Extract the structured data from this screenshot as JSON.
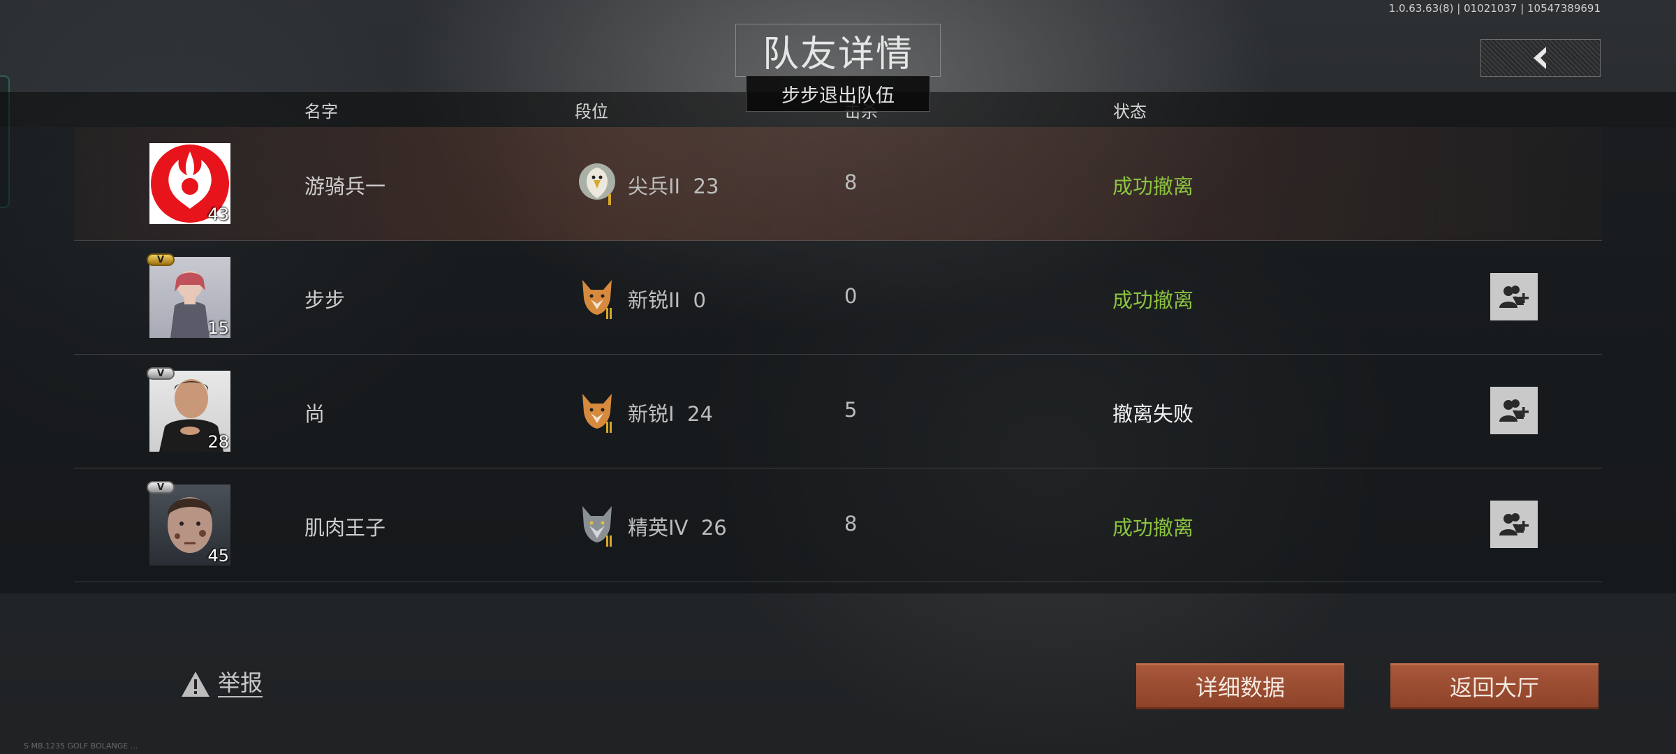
{
  "version_info": "1.0.63.63(8) | 01021037 | 10547389691",
  "title": "队友详情",
  "toast": "步步退出队伍",
  "columns": {
    "name": "名字",
    "rank": "段位",
    "kills": "击杀",
    "status": "状态"
  },
  "rows": [
    {
      "name": "游骑兵一",
      "level": "43",
      "rank": "尖兵II",
      "rank_points": "23",
      "kills": "8",
      "status": "成功撤离",
      "status_type": "success",
      "vip": "",
      "is_self": true,
      "avatar": "rebel-emblem",
      "rank_icon": "eagle-rank-icon"
    },
    {
      "name": "步步",
      "level": "15",
      "rank": "新锐II",
      "rank_points": "0",
      "kills": "0",
      "status": "成功撤离",
      "status_type": "success",
      "vip": "V",
      "vip_style": "gold",
      "is_self": false,
      "avatar": "anime-character-photo",
      "rank_icon": "fox-rank-icon"
    },
    {
      "name": "尚",
      "level": "28",
      "rank": "新锐I",
      "rank_points": "24",
      "kills": "5",
      "status": "撤离失败",
      "status_type": "fail",
      "vip": "V",
      "vip_style": "silver",
      "is_self": false,
      "avatar": "man-photo",
      "rank_icon": "fox-rank-icon"
    },
    {
      "name": "肌肉王子",
      "level": "45",
      "rank": "精英IV",
      "rank_points": "26",
      "kills": "8",
      "status": "成功撤离",
      "status_type": "success",
      "vip": "V",
      "vip_style": "silver",
      "is_self": false,
      "avatar": "dirty-face-photo",
      "rank_icon": "wolf-rank-icon"
    }
  ],
  "report_label": "举报",
  "detail_button": "详细数据",
  "return_button": "返回大厅",
  "footer_note": "S MB.1235 GOLF BOLANGE ...",
  "colors": {
    "success": "#8bc33f",
    "button": "#9a4b30",
    "rebel_red": "#e8141c"
  }
}
